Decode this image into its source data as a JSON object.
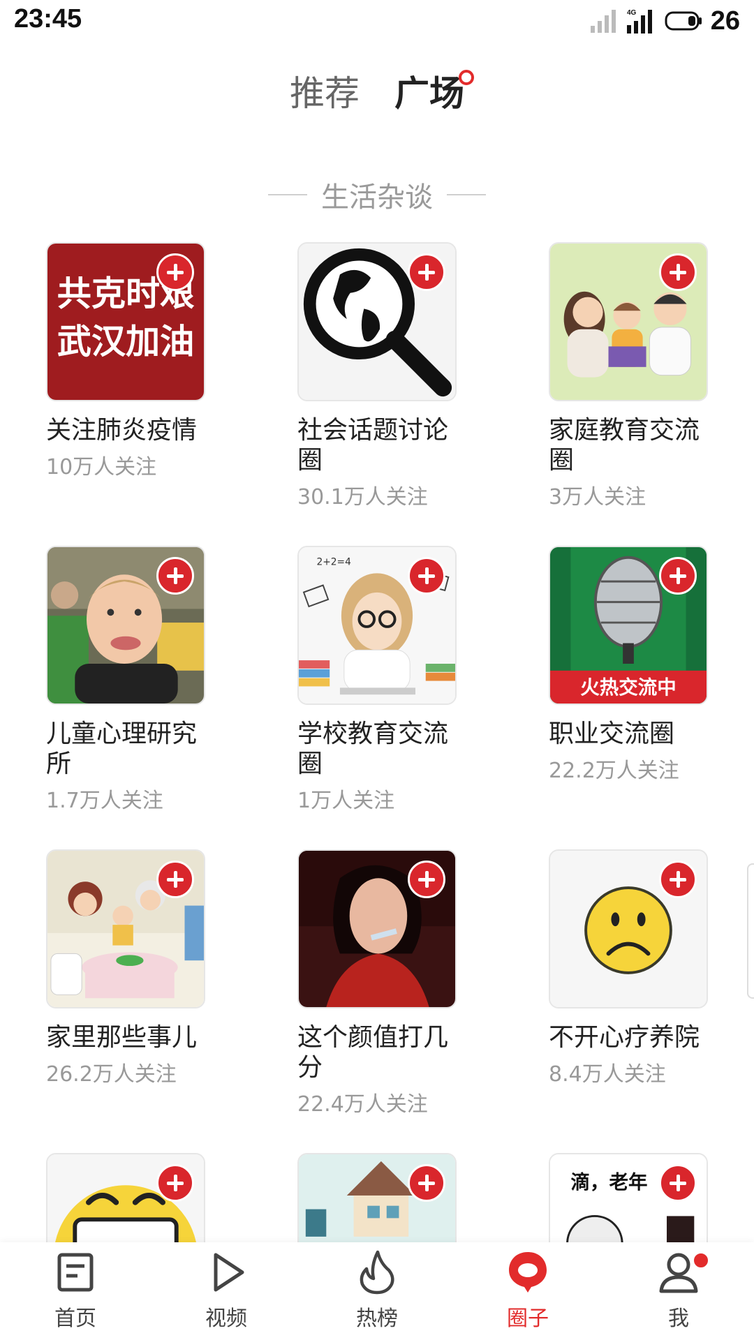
{
  "status_bar": {
    "time": "23:45",
    "network_label": "4G",
    "battery_level": "26"
  },
  "tabs": [
    {
      "label": "推荐",
      "active": false
    },
    {
      "label": "广场",
      "active": true
    }
  ],
  "section": {
    "title": "生活杂谈"
  },
  "circles": [
    {
      "name": "关注肺炎疫情",
      "followers": "10万人关注",
      "thumb_text": [
        "共克时艰",
        "武汉加油"
      ]
    },
    {
      "name": "社会话题讨论圈",
      "followers": "30.1万人关注"
    },
    {
      "name": "家庭教育交流圈",
      "followers": "3万人关注"
    },
    {
      "name": "儿童心理研究所",
      "followers": "1.7万人关注"
    },
    {
      "name": "学校教育交流圈",
      "followers": "1万人关注",
      "thumb_text": [
        "2+2=4"
      ]
    },
    {
      "name": "职业交流圈",
      "followers": "22.2万人关注",
      "thumb_text": [
        "火热交流中"
      ]
    },
    {
      "name": "家里那些事儿",
      "followers": "26.2万人关注"
    },
    {
      "name": "这个颜值打几分",
      "followers": "22.4万人关注"
    },
    {
      "name": "不开心疗养院",
      "followers": "8.4万人关注"
    },
    {
      "name": "",
      "followers": ""
    },
    {
      "name": "",
      "followers": ""
    },
    {
      "name": "",
      "followers": "",
      "thumb_text": [
        "滴，老年"
      ]
    }
  ],
  "bottom_nav": [
    {
      "label": "首页",
      "icon": "article-icon",
      "active": false
    },
    {
      "label": "视频",
      "icon": "play-icon",
      "active": false
    },
    {
      "label": "热榜",
      "icon": "flame-icon",
      "active": false
    },
    {
      "label": "圈子",
      "icon": "circle-chat-icon",
      "active": true
    },
    {
      "label": "我",
      "icon": "person-icon",
      "active": false,
      "badge": true
    }
  ],
  "colors": {
    "accent": "#d9262c",
    "text": "#222222",
    "muted": "#999999"
  }
}
